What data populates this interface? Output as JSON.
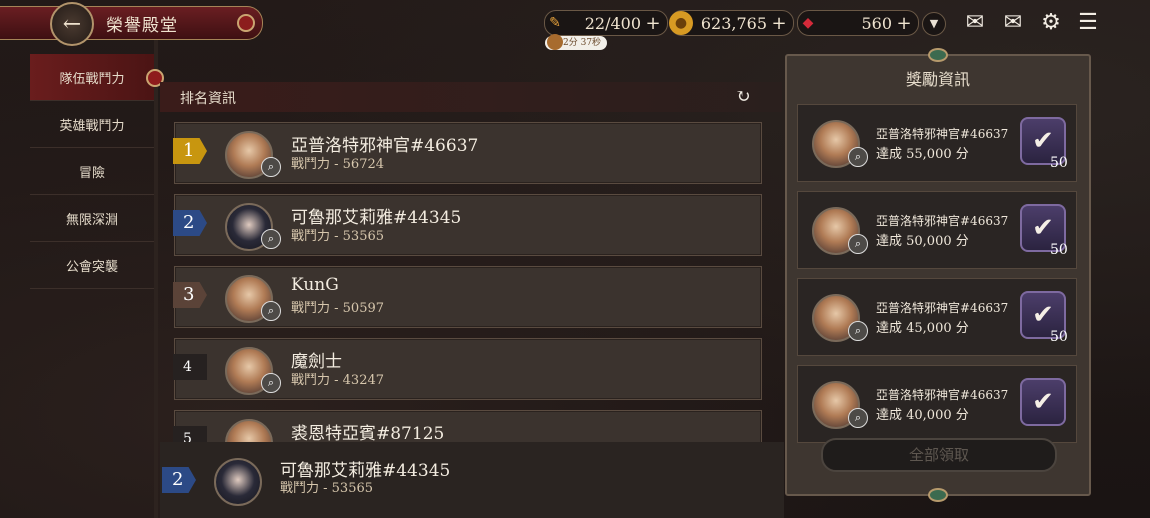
{
  "header": {
    "title": "榮譽殿堂",
    "resources": [
      {
        "icon": "stamina-icon",
        "value": "22/400"
      },
      {
        "icon": "gold-coin-icon",
        "value": "623,765"
      },
      {
        "icon": "red-crystal-icon",
        "value": "560"
      }
    ],
    "stamina_timer": "2分 37秒"
  },
  "nav": {
    "items": [
      {
        "label": "隊伍戰鬥力"
      },
      {
        "label": "英雄戰鬥力"
      },
      {
        "label": "冒險"
      },
      {
        "label": "無限深淵"
      },
      {
        "label": "公會突襲"
      }
    ]
  },
  "ranking": {
    "title": "排名資訊",
    "rows": [
      {
        "rank": "1",
        "name": "亞普洛特邪神官#46637",
        "power": "戰鬥力 - 56724"
      },
      {
        "rank": "2",
        "name": "可魯那艾莉雅#44345",
        "power": "戰鬥力 - 53565"
      },
      {
        "rank": "3",
        "name": "KunG",
        "power": "戰鬥力 - 50597"
      },
      {
        "rank": "4",
        "name": "魔劍士",
        "power": "戰鬥力 - 43247"
      },
      {
        "rank": "5",
        "name": "裘恩特亞賓#87125",
        "power": ""
      }
    ],
    "my_rank": {
      "rank": "2",
      "name": "可魯那艾莉雅#44345",
      "power": "戰鬥力 - 53565"
    }
  },
  "rewards": {
    "title": "獎勵資訊",
    "items": [
      {
        "name": "亞普洛特邪神官#46637",
        "goal": "達成 55,000 分",
        "qty": "50"
      },
      {
        "name": "亞普洛特邪神官#46637",
        "goal": "達成 50,000 分",
        "qty": "50"
      },
      {
        "name": "亞普洛特邪神官#46637",
        "goal": "達成 45,000 分",
        "qty": "50"
      },
      {
        "name": "亞普洛特邪神官#46637",
        "goal": "達成 40,000 分",
        "qty": ""
      }
    ],
    "claim_all_label": "全部領取"
  },
  "colors": {
    "rank1": "#c8960f",
    "rank2": "#2c4a86",
    "rank3": "#5b4338",
    "rank_other": "#262120"
  }
}
